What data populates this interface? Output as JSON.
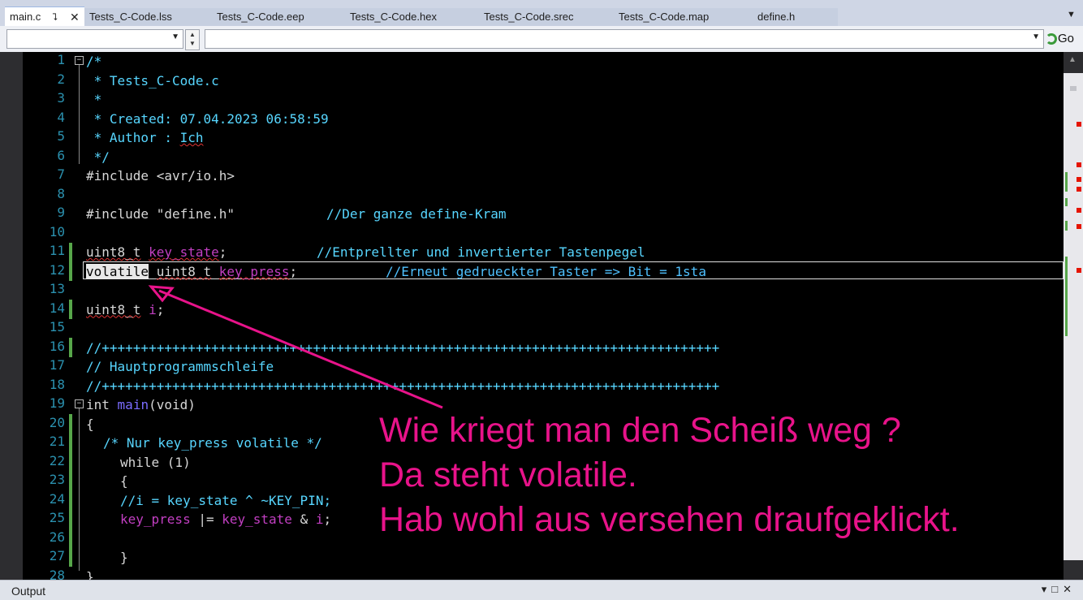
{
  "tabs": {
    "active": {
      "label": "main.c",
      "pin": "⮧",
      "close": "✕"
    },
    "others": [
      "Tests_C-Code.lss",
      "Tests_C-Code.eep",
      "Tests_C-Code.hex",
      "Tests_C-Code.srec",
      "Tests_C-Code.map",
      "define.h"
    ]
  },
  "nav": {
    "go_label": "Go"
  },
  "code": {
    "line_numbers": [
      "1",
      "2",
      "3",
      "4",
      "5",
      "6",
      "7",
      "8",
      "9",
      "10",
      "11",
      "12",
      "13",
      "14",
      "15",
      "16",
      "17",
      "18",
      "19",
      "20",
      "21",
      "22",
      "23",
      "24",
      "25",
      "26",
      "27",
      "28"
    ],
    "l1": "/*",
    "l2": " * Tests_C-Code.c",
    "l3": " *",
    "l4": " * Created: 07.04.2023 06:58:59",
    "l5a": " * Author : ",
    "l5b": "Ich",
    "l6": " */",
    "l7": "#include <avr/io.h>",
    "l9a": "#include \"define.h\"",
    "l9b": "//Der ganze define-Kram",
    "l11a": "uint8_t",
    "l11b": "key_state",
    "l11c": ";",
    "l11d": "//Entprellter und invertierter Tastenpegel",
    "l12a": "volatile",
    "l12b": "uint8_t",
    "l12c": "key_press",
    "l12d": ";",
    "l12e": "//Erneut gedrueckter Taster => Bit = 1sta",
    "l14a": "uint8_t",
    "l14b": "i",
    "l14c": ";",
    "l16": "//+++++++++++++++++++++++++++++++++++++++++++++++++++++++++++++++++++++++++++++++",
    "l17": "// Hauptprogrammschleife",
    "l18": "//+++++++++++++++++++++++++++++++++++++++++++++++++++++++++++++++++++++++++++++++",
    "l19a": "int",
    "l19b": "main",
    "l19c": "(void)",
    "l20": "{",
    "l21": "/* Nur key_press volatile */",
    "l22": "while (1)",
    "l23": "{",
    "l24": "//i = key_state ^ ~KEY_PIN;",
    "l25a": "key_press",
    "l25b": " |= ",
    "l25c": "key_state",
    "l25d": " & ",
    "l25e": "i",
    "l25f": ";",
    "l27": "}",
    "l28": "}"
  },
  "annotation": {
    "line1": "Wie kriegt man den Scheiß weg ?",
    "line2": "Da steht volatile.",
    "line3": "Hab wohl aus versehen draufgeklickt."
  },
  "output_panel": {
    "title": "Output",
    "controls": "▾□✕"
  },
  "colors": {
    "annotation": "#e8138a",
    "comment": "#57d6ff",
    "identifier": "#c23fc2"
  }
}
